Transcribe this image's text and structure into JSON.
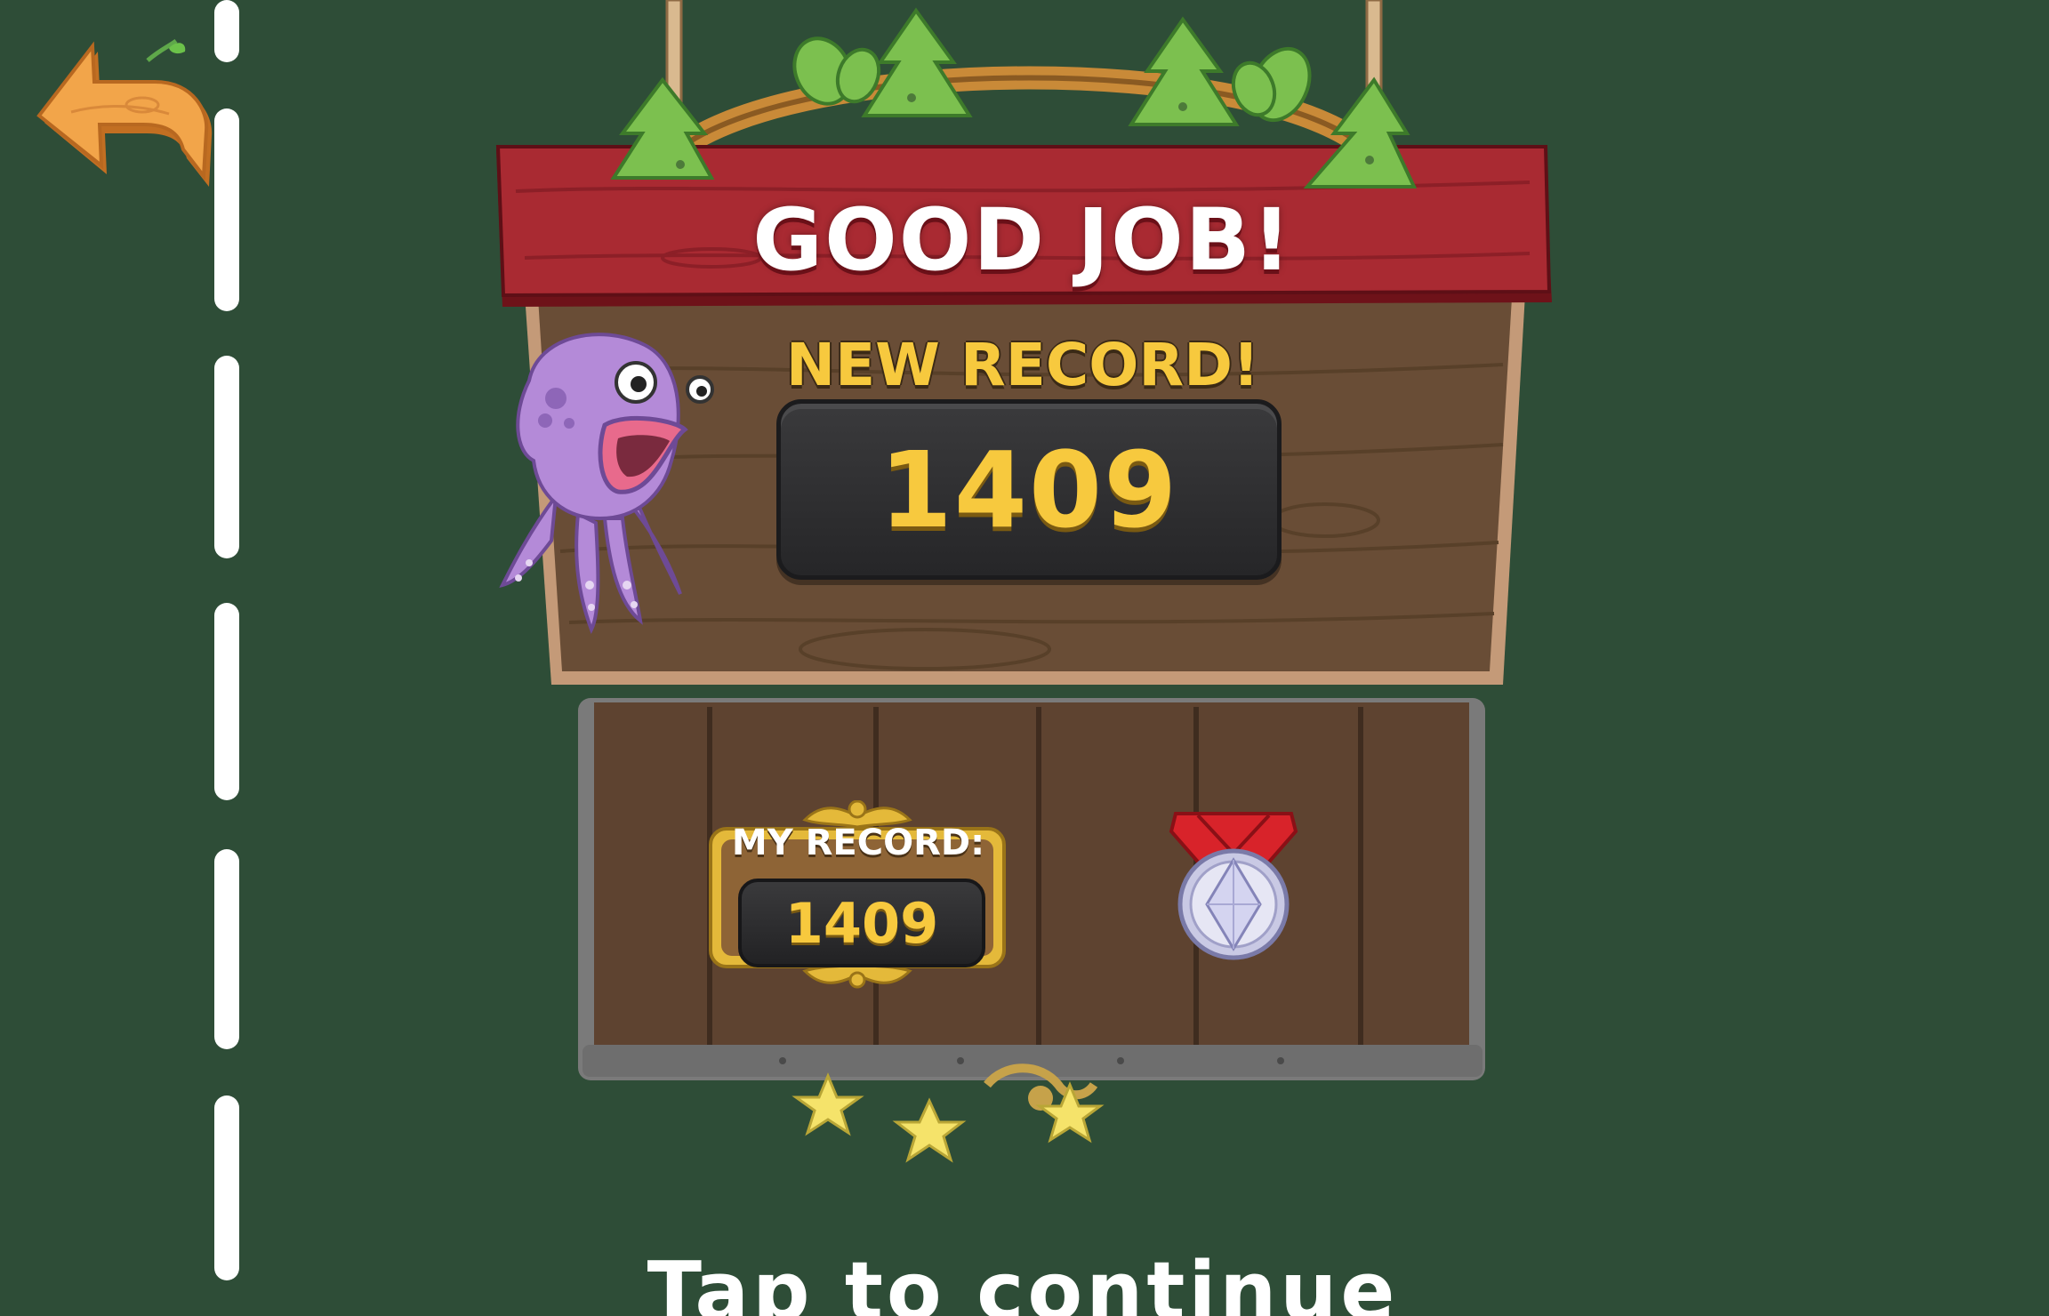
{
  "results": {
    "title": "GOOD JOB!",
    "new_record_label": "NEW RECORD!",
    "score": "1409",
    "my_record_label": "MY RECORD:",
    "my_record_value": "1409",
    "medal": "silver-diamond-medal-icon"
  },
  "footer": {
    "text": "Tap to continue"
  },
  "icons": {
    "back": "back-arrow-icon",
    "mascot": "octopus-mascot",
    "stars": 3
  },
  "colors": {
    "background": "#2e4d37",
    "board_red": "#a92a32",
    "wood": "#6b4f37",
    "score_gold": "#f7c93e",
    "arrow_orange": "#f2a54a"
  }
}
